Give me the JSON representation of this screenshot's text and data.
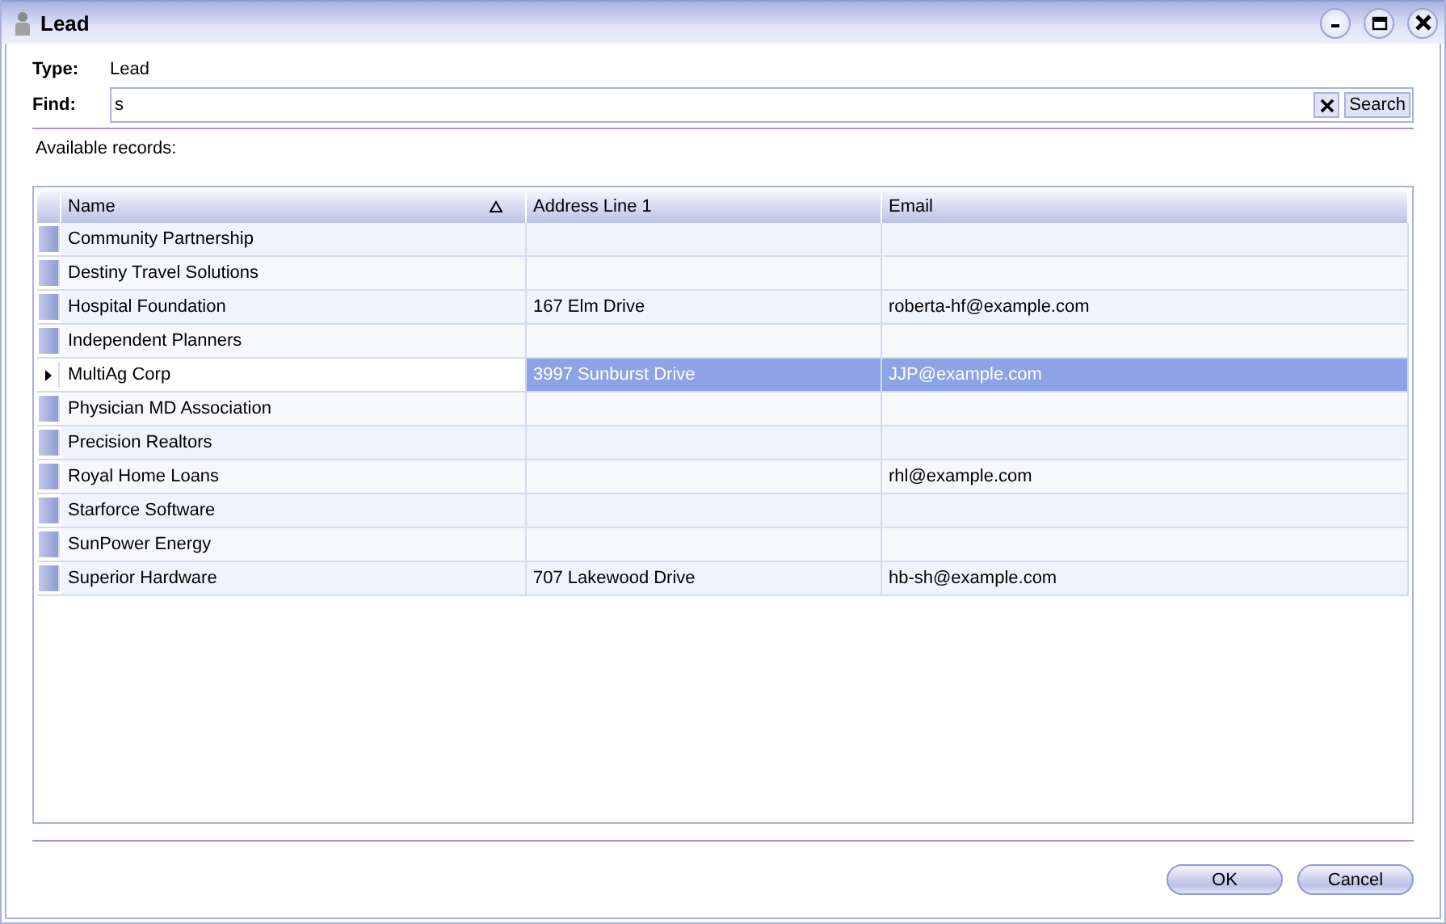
{
  "window": {
    "title": "Lead"
  },
  "type": {
    "label": "Type:",
    "value": "Lead"
  },
  "find": {
    "label": "Find:",
    "value": "s",
    "search_button": "Search"
  },
  "available_label": "Available records:",
  "table": {
    "columns": [
      {
        "label": "Name",
        "sorted": true
      },
      {
        "label": "Address Line 1",
        "sorted": false
      },
      {
        "label": "Email",
        "sorted": false
      }
    ],
    "rows": [
      {
        "cells": [
          "Community Partnership",
          "",
          ""
        ],
        "selected": false
      },
      {
        "cells": [
          "Destiny Travel Solutions",
          "",
          ""
        ],
        "selected": false
      },
      {
        "cells": [
          "Hospital Foundation",
          "167 Elm Drive",
          "roberta-hf@example.com"
        ],
        "selected": false
      },
      {
        "cells": [
          "Independent Planners",
          "",
          ""
        ],
        "selected": false
      },
      {
        "cells": [
          "MultiAg Corp",
          "3997 Sunburst Drive",
          "JJP@example.com"
        ],
        "selected": true
      },
      {
        "cells": [
          "Physician MD Association",
          "",
          ""
        ],
        "selected": false
      },
      {
        "cells": [
          "Precision Realtors",
          "",
          ""
        ],
        "selected": false
      },
      {
        "cells": [
          "Royal Home Loans",
          "",
          "rhl@example.com"
        ],
        "selected": false
      },
      {
        "cells": [
          "Starforce Software",
          "",
          ""
        ],
        "selected": false
      },
      {
        "cells": [
          "SunPower Energy",
          "",
          ""
        ],
        "selected": false
      },
      {
        "cells": [
          "Superior Hardware",
          "707 Lakewood Drive",
          "hb-sh@example.com"
        ],
        "selected": false
      }
    ]
  },
  "buttons": [
    "OK",
    "Cancel"
  ]
}
